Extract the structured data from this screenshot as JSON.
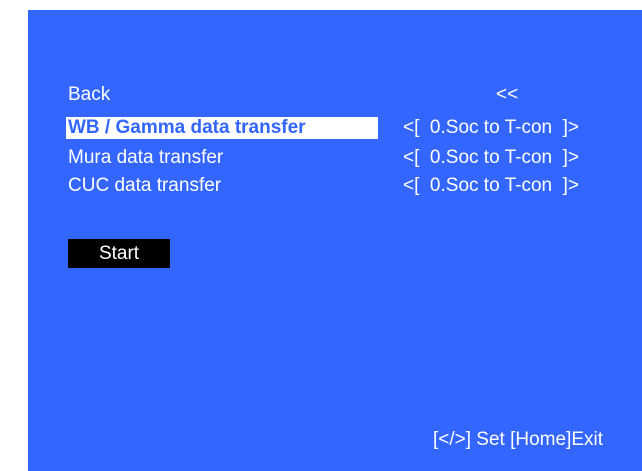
{
  "menu": {
    "back": {
      "label": "Back",
      "value": "<<"
    },
    "items": [
      {
        "label": "WB / Gamma data transfer",
        "value": "<[  0.Soc to T-con  ]>",
        "selected": true
      },
      {
        "label": "Mura data transfer",
        "value": "<[  0.Soc to T-con  ]>",
        "selected": false
      },
      {
        "label": "CUC data transfer",
        "value": "<[  0.Soc to T-con  ]>",
        "selected": false
      }
    ]
  },
  "start_label": "Start",
  "footer_hint": "[</>] Set [Home]Exit",
  "colors": {
    "background": "#3366ff",
    "text": "#ffffff",
    "highlight": "#ffffff",
    "button": "#000000"
  }
}
